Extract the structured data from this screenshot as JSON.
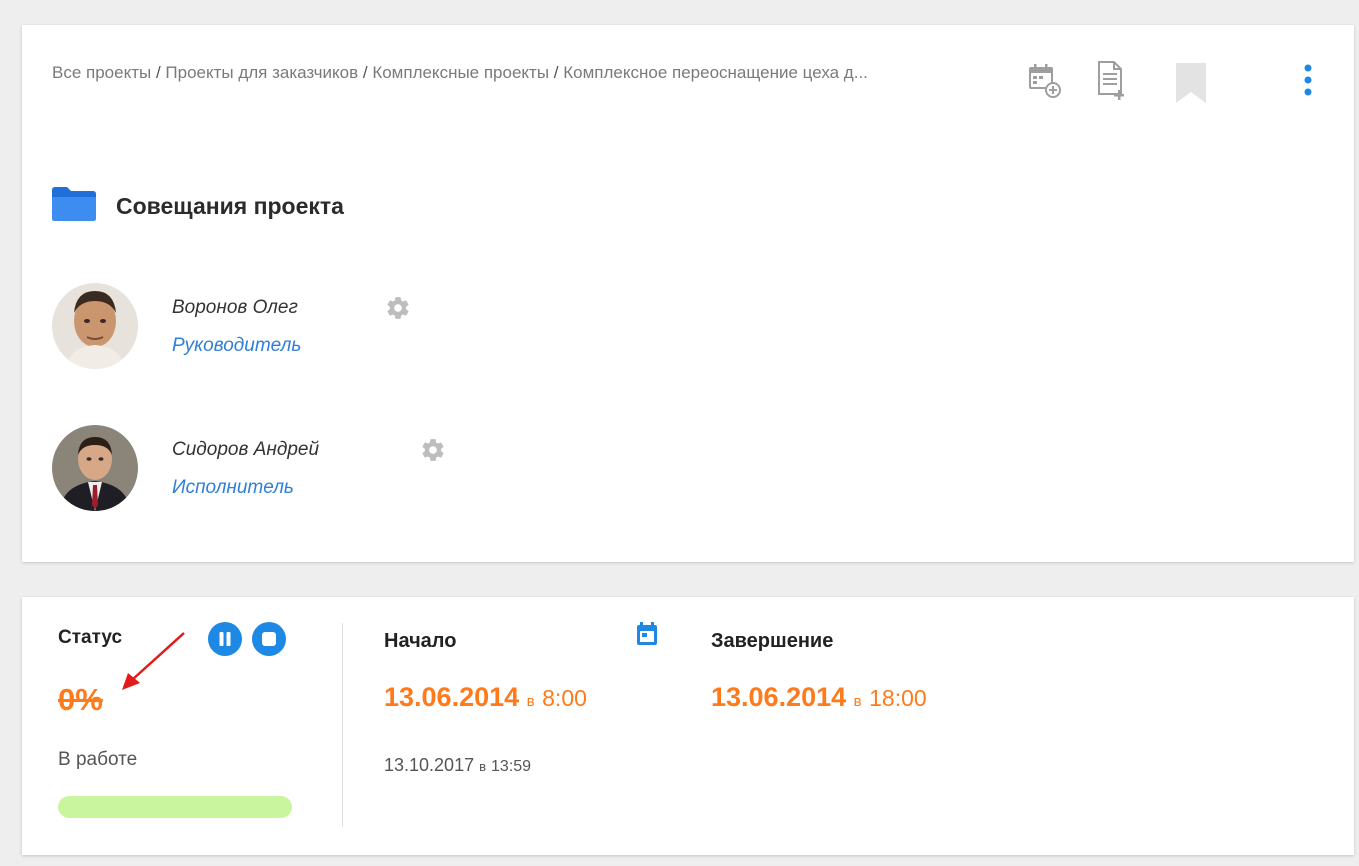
{
  "breadcrumb": {
    "items": [
      "Все проекты",
      "Проекты для заказчиков",
      "Комплексные проекты",
      "Комплексное переоснащение цеха д..."
    ],
    "separator": " / "
  },
  "toolbar": {
    "icons": [
      "calendar-add-icon",
      "document-add-icon",
      "bookmark-icon",
      "more-vert-icon"
    ]
  },
  "page": {
    "title": "Совещания проекта",
    "icon": "folder-icon"
  },
  "members": [
    {
      "name": "Воронов Олег",
      "role": "Руководитель"
    },
    {
      "name": "Сидоров Андрей",
      "role": "Исполнитель"
    }
  ],
  "status": {
    "label": "Статус",
    "percent": "0%",
    "state": "В работе",
    "progress_fraction": 0
  },
  "schedule": {
    "start_label": "Начало",
    "end_label": "Завершение",
    "start_date": "13.06.2014",
    "start_at_word": "в",
    "start_time": "8:00",
    "end_date": "13.06.2014",
    "end_at_word": "в",
    "end_time": "18:00",
    "created_date": "13.10.2017",
    "created_at_word": "в",
    "created_time": "13:59"
  },
  "colors": {
    "accent_blue": "#1e88e5",
    "link_blue": "#2f7fd8",
    "orange": "#ff7a1a",
    "progress_green": "#c9f59e",
    "annotation_red": "#e11b1b"
  }
}
